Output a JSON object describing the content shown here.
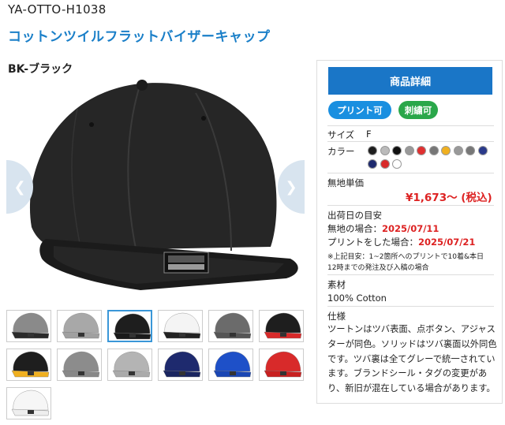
{
  "header": {
    "sku": "YA-OTTO-H1038",
    "title": "コットンツイルフラットバイザーキャップ",
    "variant": "BK-ブラック"
  },
  "gallery": {
    "main_image": "black-flat-visor-cap",
    "prev_icon": "chevron-left-icon",
    "next_icon": "chevron-right-icon",
    "thumbnails": [
      {
        "name": "gray-black-cap",
        "crown": "#8a8a8a",
        "visor": "#2a2a2a"
      },
      {
        "name": "light-gray-cap",
        "crown": "#a8a8a8",
        "visor": "#a0a0a0"
      },
      {
        "name": "black-cap",
        "crown": "#1e1e1e",
        "visor": "#1a1a1a",
        "selected": true
      },
      {
        "name": "white-black-cap",
        "crown": "#f4f4f4",
        "visor": "#222"
      },
      {
        "name": "charcoal-cap",
        "crown": "#6b6b6b",
        "visor": "#555"
      },
      {
        "name": "black-red-cap",
        "crown": "#1e1e1e",
        "visor": "#d82a2a"
      },
      {
        "name": "black-yellow-cap",
        "crown": "#1e1e1e",
        "visor": "#f0b020"
      },
      {
        "name": "gray-cap",
        "crown": "#8c8c8c",
        "visor": "#888"
      },
      {
        "name": "silver-cap",
        "crown": "#b4b4b4",
        "visor": "#aaa"
      },
      {
        "name": "navy-cap",
        "crown": "#1e2a6e",
        "visor": "#1a2560"
      },
      {
        "name": "royal-blue-cap",
        "crown": "#1e50c8",
        "visor": "#1a46b4"
      },
      {
        "name": "red-cap",
        "crown": "#d82a2a",
        "visor": "#c82020"
      },
      {
        "name": "white-cap",
        "crown": "#f6f6f6",
        "visor": "#eeeeee"
      }
    ]
  },
  "panel": {
    "detail_button": "商品詳細",
    "badge_print": "プリント可",
    "badge_embroidery": "刺繍可",
    "size_label": "サイズ",
    "size_value": "F",
    "color_label": "カラー",
    "colors": [
      "#1e1e1e",
      "#bbbbbb",
      "#111111",
      "#999999",
      "#e03030",
      "#777777",
      "#f0b020",
      "#999999",
      "#777777",
      "#2a3a8a",
      "#1e2a6e",
      "#d82a2a",
      "#ffffff"
    ],
    "price_label": "無地単価",
    "price": "¥1,673～ (税込)",
    "ship_label": "出荷日の目安",
    "ship_plain_label": "無地の場合：",
    "ship_plain_date": "2025/07/11",
    "ship_print_label": "プリントをした場合：",
    "ship_print_date": "2025/07/21",
    "ship_note_line1": "※上記目安：1~2箇所へのプリントで10着&本日",
    "ship_note_line2": "12時までの発注及び入稿の場合",
    "material_label": "素材",
    "material_value": "100% Cotton",
    "spec_label": "仕様",
    "spec_lines": [
      "ツートンはツバ表面、点ボタン、アジャス",
      "ターが同色。ソリッドはツバ裏面以外同色",
      "です。ツバ裏は全てグレーで統一されてい",
      "ます。ブランドシール・タグの変更があ",
      "り、新旧が混在している場合があります。"
    ]
  }
}
